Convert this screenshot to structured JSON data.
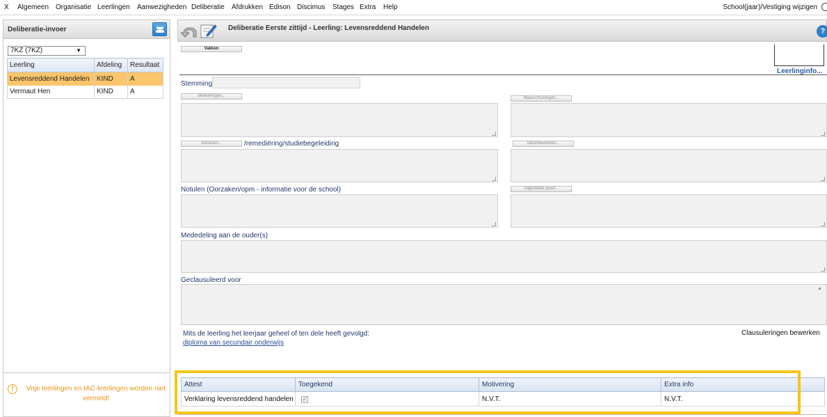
{
  "menu": {
    "items": [
      "X",
      "Algemeen",
      "Organisatie",
      "Leerlingen",
      "Aanwezigheden",
      "Deliberatie",
      "Afdrukken",
      "Edison",
      "Discimus",
      "Stages",
      "Extra",
      "Help"
    ],
    "right": "School(jaar)/Vestiging wijzigen"
  },
  "sidebar": {
    "title": "Deliberatie-invoer",
    "class_select": "7KZ (7KZ)",
    "columns": [
      "Leerling",
      "Afdeling",
      "Resultaat"
    ],
    "rows": [
      {
        "name": "Levensreddend Handelen",
        "afdeling": "KIND",
        "resultaat": "A",
        "selected": true
      },
      {
        "name": "Vermaut Hen",
        "afdeling": "KIND",
        "resultaat": "A",
        "selected": false
      }
    ],
    "warning": "Vrije leerlingen en IAC-leerlingen worden niet vermeld!"
  },
  "main": {
    "title": "Deliberatie Eerste zittijd - Leerling: Levensreddend Handelen",
    "vakken_btn": "Vakken",
    "leerlinginfo": "Leerlinginfo...",
    "stemming_label": "Stemming",
    "motiveringen_btn": "Motiveringen...",
    "waarschuwingen_btn": "Waarschuwingen...",
    "adviezen_btn": "Adviezen...",
    "remediering_label": "/remediëring/studiebegeleiding",
    "vakantiewerken_btn": "Vakantiewerken...",
    "notulen_label": "Notulen (Oorzaken/opm - informatie voor de school)",
    "uitgestelde_btn": "Uitgestelde proef...",
    "mededeling_label": "Mededeling aan de ouder(s)",
    "geclausuleerd_label": "Geclausuleerd voor",
    "mits_text": "Mits de leerling het leerjaar geheel of ten dele heeft gevolgd:",
    "diploma_link": "diploma van secundair onderwijs",
    "clausuleringen": "Clausuleringen bewerken"
  },
  "attest": {
    "columns": [
      "Attest",
      "Toegekend",
      "Motivering",
      "Extra info"
    ],
    "row": {
      "attest": "Verklaring levensreddend handelen",
      "toegekend": "✓",
      "motivering": "N.V.T.",
      "extra": "N.V.T."
    }
  },
  "colors": {
    "selection": "#fbc56b",
    "highlight": "#f5c518",
    "warning": "#e8961a",
    "link": "#2a4f95"
  }
}
